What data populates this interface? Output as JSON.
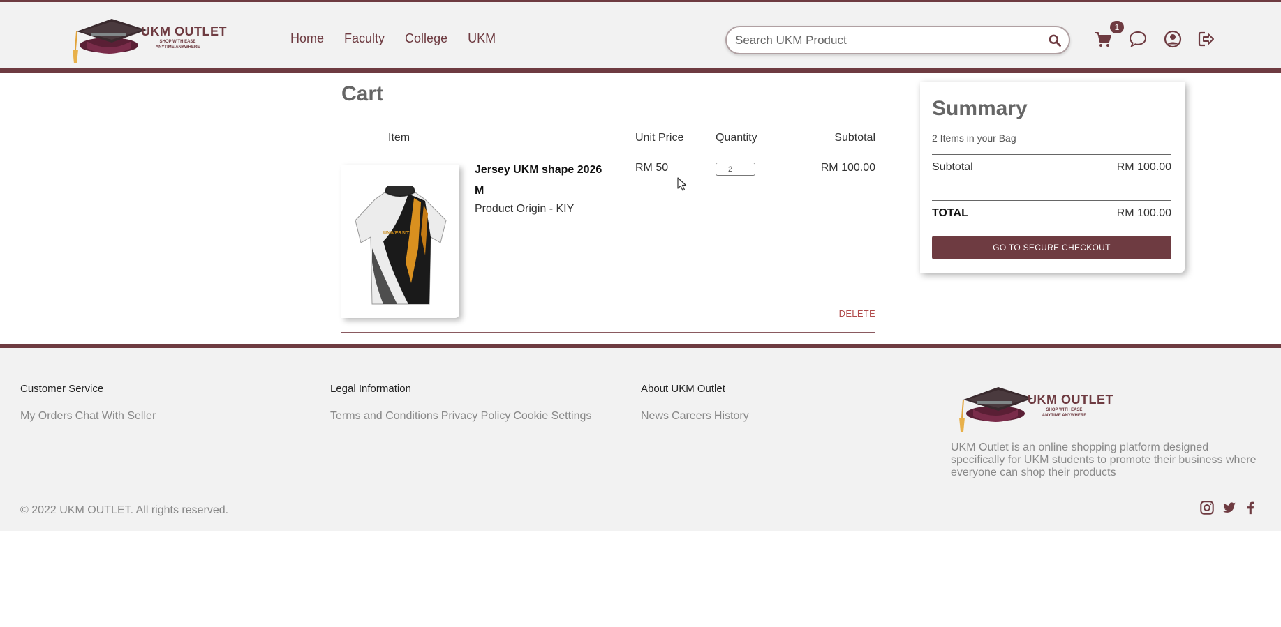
{
  "header": {
    "logo": {
      "title": "UKM OUTLET",
      "tagline_1": "SHOP WITH EASE",
      "tagline_2": "ANYTIME ANYWHERE"
    },
    "nav": [
      "Home",
      "Faculty",
      "College",
      "UKM"
    ],
    "search": {
      "placeholder": "Search UKM Product",
      "value": ""
    },
    "cart_badge": "1",
    "icons": [
      "cart-icon",
      "chat-icon",
      "user-icon",
      "logout-icon",
      "search-icon"
    ]
  },
  "cart": {
    "title": "Cart",
    "columns": {
      "item": "Item",
      "unit_price": "Unit Price",
      "quantity": "Quantity",
      "subtotal": "Subtotal"
    },
    "items": [
      {
        "name": "Jersey UKM shape 2026 M",
        "origin": "Product Origin - KIY",
        "unit_price": "RM 50",
        "quantity": "2",
        "subtotal": "RM 100.00",
        "delete_label": "DELETE"
      }
    ]
  },
  "summary": {
    "title": "Summary",
    "count_text": "2 Items in your Bag",
    "subtotal_label": "Subtotal",
    "subtotal_value": "RM 100.00",
    "total_label": "TOTAL",
    "total_value": "RM 100.00",
    "checkout_label": "GO TO SECURE CHECKOUT"
  },
  "footer": {
    "customer_service": {
      "heading": "Customer Service",
      "links": [
        "My Orders",
        "Chat With Seller"
      ]
    },
    "legal": {
      "heading": "Legal Information",
      "links": [
        "Terms and Conditions",
        "Privacy Policy",
        "Cookie Settings"
      ]
    },
    "about": {
      "heading": "About UKM Outlet",
      "links": [
        "News",
        "Careers",
        "History"
      ]
    },
    "description": "UKM Outlet is an online shopping platform designed specifically for UKM students to promote their business where everyone can shop their products",
    "copyright": "© 2022 UKM OUTLET. All rights reserved.",
    "social": [
      "instagram-icon",
      "twitter-icon",
      "facebook-icon"
    ]
  },
  "colors": {
    "brand": "#6e3b41",
    "background": "#f2f2f2",
    "muted_text": "#888888",
    "delete": "#b04a4a"
  }
}
